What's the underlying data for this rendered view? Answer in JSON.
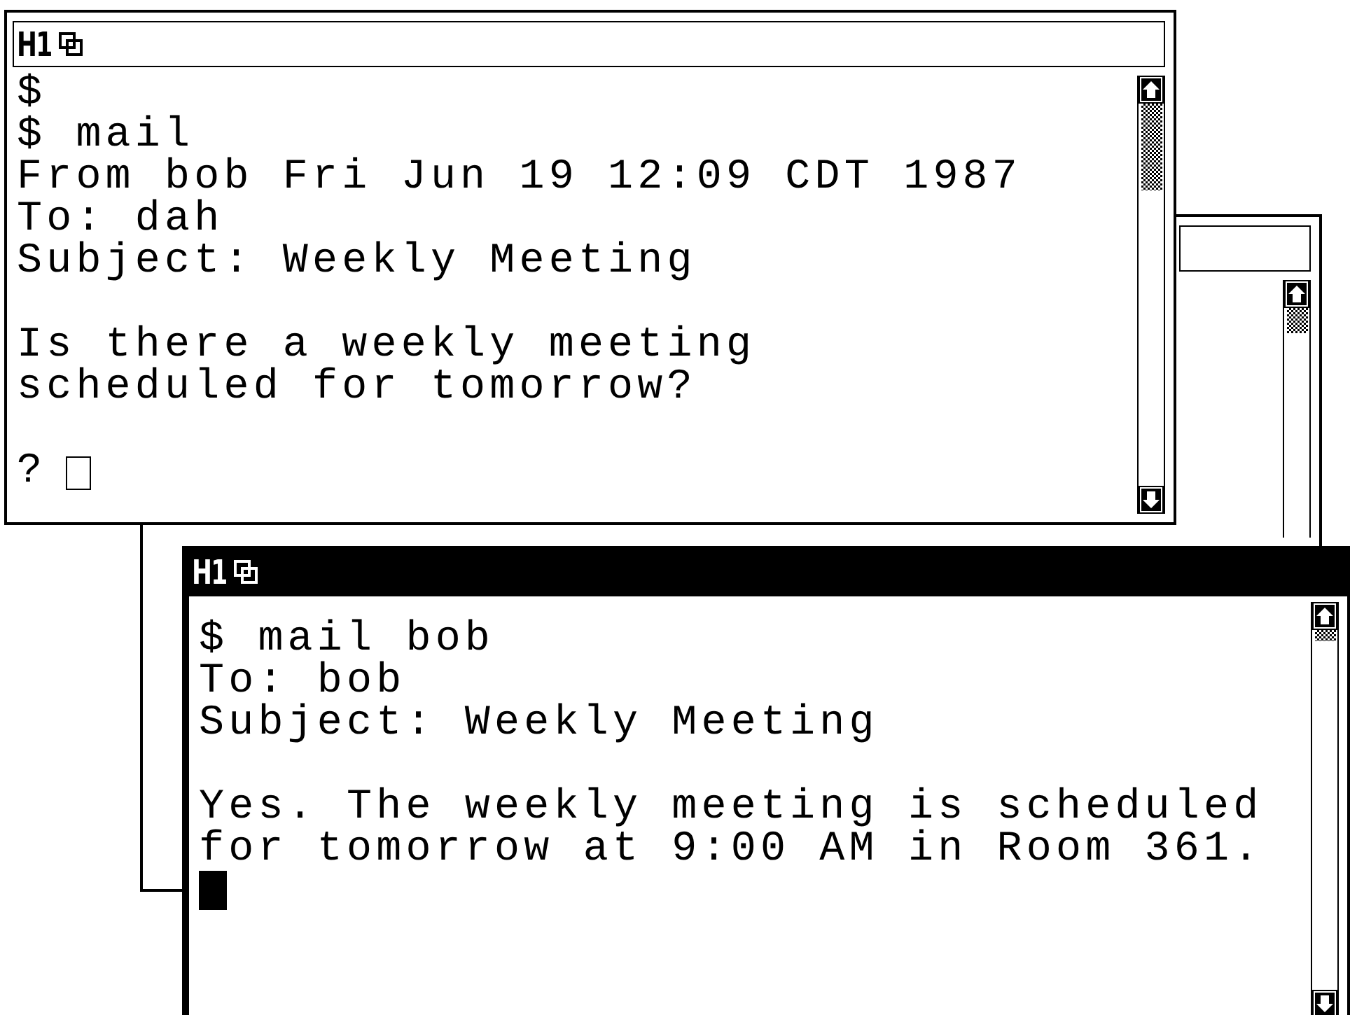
{
  "windows": [
    {
      "title": "H1",
      "active": false,
      "blocks": [
        [
          "$",
          "$ mail",
          "From bob Fri Jun 19 12:09 CDT 1987",
          "To: dah",
          "Subject: Weekly Meeting"
        ],
        [
          "Is there a weekly meeting",
          "scheduled for tomorrow?"
        ],
        [
          {
            "kind": "cursor",
            "prompt": "?"
          }
        ]
      ]
    },
    {
      "active": false
    },
    {
      "title": "H1",
      "active": true,
      "blocks": [
        [
          "$ mail bob",
          "To: bob",
          "Subject: Weekly Meeting"
        ],
        [
          "Yes. The weekly meeting is scheduled",
          "for tomorrow at 9:00 AM in Room 361.",
          {
            "kind": "cursor"
          }
        ]
      ]
    }
  ]
}
